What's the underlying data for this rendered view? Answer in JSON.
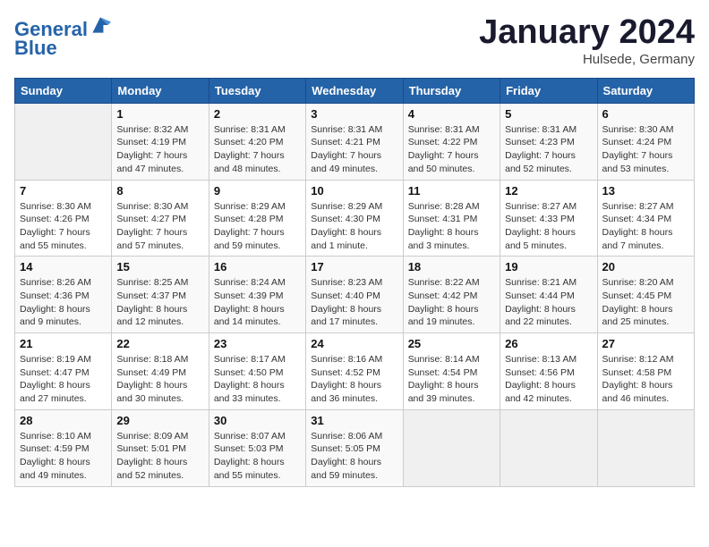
{
  "header": {
    "logo_line1": "General",
    "logo_line2": "Blue",
    "month": "January 2024",
    "location": "Hulsede, Germany"
  },
  "columns": [
    "Sunday",
    "Monday",
    "Tuesday",
    "Wednesday",
    "Thursday",
    "Friday",
    "Saturday"
  ],
  "weeks": [
    [
      {
        "day": "",
        "info": ""
      },
      {
        "day": "1",
        "info": "Sunrise: 8:32 AM\nSunset: 4:19 PM\nDaylight: 7 hours\nand 47 minutes."
      },
      {
        "day": "2",
        "info": "Sunrise: 8:31 AM\nSunset: 4:20 PM\nDaylight: 7 hours\nand 48 minutes."
      },
      {
        "day": "3",
        "info": "Sunrise: 8:31 AM\nSunset: 4:21 PM\nDaylight: 7 hours\nand 49 minutes."
      },
      {
        "day": "4",
        "info": "Sunrise: 8:31 AM\nSunset: 4:22 PM\nDaylight: 7 hours\nand 50 minutes."
      },
      {
        "day": "5",
        "info": "Sunrise: 8:31 AM\nSunset: 4:23 PM\nDaylight: 7 hours\nand 52 minutes."
      },
      {
        "day": "6",
        "info": "Sunrise: 8:30 AM\nSunset: 4:24 PM\nDaylight: 7 hours\nand 53 minutes."
      }
    ],
    [
      {
        "day": "7",
        "info": "Sunrise: 8:30 AM\nSunset: 4:26 PM\nDaylight: 7 hours\nand 55 minutes."
      },
      {
        "day": "8",
        "info": "Sunrise: 8:30 AM\nSunset: 4:27 PM\nDaylight: 7 hours\nand 57 minutes."
      },
      {
        "day": "9",
        "info": "Sunrise: 8:29 AM\nSunset: 4:28 PM\nDaylight: 7 hours\nand 59 minutes."
      },
      {
        "day": "10",
        "info": "Sunrise: 8:29 AM\nSunset: 4:30 PM\nDaylight: 8 hours\nand 1 minute."
      },
      {
        "day": "11",
        "info": "Sunrise: 8:28 AM\nSunset: 4:31 PM\nDaylight: 8 hours\nand 3 minutes."
      },
      {
        "day": "12",
        "info": "Sunrise: 8:27 AM\nSunset: 4:33 PM\nDaylight: 8 hours\nand 5 minutes."
      },
      {
        "day": "13",
        "info": "Sunrise: 8:27 AM\nSunset: 4:34 PM\nDaylight: 8 hours\nand 7 minutes."
      }
    ],
    [
      {
        "day": "14",
        "info": "Sunrise: 8:26 AM\nSunset: 4:36 PM\nDaylight: 8 hours\nand 9 minutes."
      },
      {
        "day": "15",
        "info": "Sunrise: 8:25 AM\nSunset: 4:37 PM\nDaylight: 8 hours\nand 12 minutes."
      },
      {
        "day": "16",
        "info": "Sunrise: 8:24 AM\nSunset: 4:39 PM\nDaylight: 8 hours\nand 14 minutes."
      },
      {
        "day": "17",
        "info": "Sunrise: 8:23 AM\nSunset: 4:40 PM\nDaylight: 8 hours\nand 17 minutes."
      },
      {
        "day": "18",
        "info": "Sunrise: 8:22 AM\nSunset: 4:42 PM\nDaylight: 8 hours\nand 19 minutes."
      },
      {
        "day": "19",
        "info": "Sunrise: 8:21 AM\nSunset: 4:44 PM\nDaylight: 8 hours\nand 22 minutes."
      },
      {
        "day": "20",
        "info": "Sunrise: 8:20 AM\nSunset: 4:45 PM\nDaylight: 8 hours\nand 25 minutes."
      }
    ],
    [
      {
        "day": "21",
        "info": "Sunrise: 8:19 AM\nSunset: 4:47 PM\nDaylight: 8 hours\nand 27 minutes."
      },
      {
        "day": "22",
        "info": "Sunrise: 8:18 AM\nSunset: 4:49 PM\nDaylight: 8 hours\nand 30 minutes."
      },
      {
        "day": "23",
        "info": "Sunrise: 8:17 AM\nSunset: 4:50 PM\nDaylight: 8 hours\nand 33 minutes."
      },
      {
        "day": "24",
        "info": "Sunrise: 8:16 AM\nSunset: 4:52 PM\nDaylight: 8 hours\nand 36 minutes."
      },
      {
        "day": "25",
        "info": "Sunrise: 8:14 AM\nSunset: 4:54 PM\nDaylight: 8 hours\nand 39 minutes."
      },
      {
        "day": "26",
        "info": "Sunrise: 8:13 AM\nSunset: 4:56 PM\nDaylight: 8 hours\nand 42 minutes."
      },
      {
        "day": "27",
        "info": "Sunrise: 8:12 AM\nSunset: 4:58 PM\nDaylight: 8 hours\nand 46 minutes."
      }
    ],
    [
      {
        "day": "28",
        "info": "Sunrise: 8:10 AM\nSunset: 4:59 PM\nDaylight: 8 hours\nand 49 minutes."
      },
      {
        "day": "29",
        "info": "Sunrise: 8:09 AM\nSunset: 5:01 PM\nDaylight: 8 hours\nand 52 minutes."
      },
      {
        "day": "30",
        "info": "Sunrise: 8:07 AM\nSunset: 5:03 PM\nDaylight: 8 hours\nand 55 minutes."
      },
      {
        "day": "31",
        "info": "Sunrise: 8:06 AM\nSunset: 5:05 PM\nDaylight: 8 hours\nand 59 minutes."
      },
      {
        "day": "",
        "info": ""
      },
      {
        "day": "",
        "info": ""
      },
      {
        "day": "",
        "info": ""
      }
    ]
  ]
}
